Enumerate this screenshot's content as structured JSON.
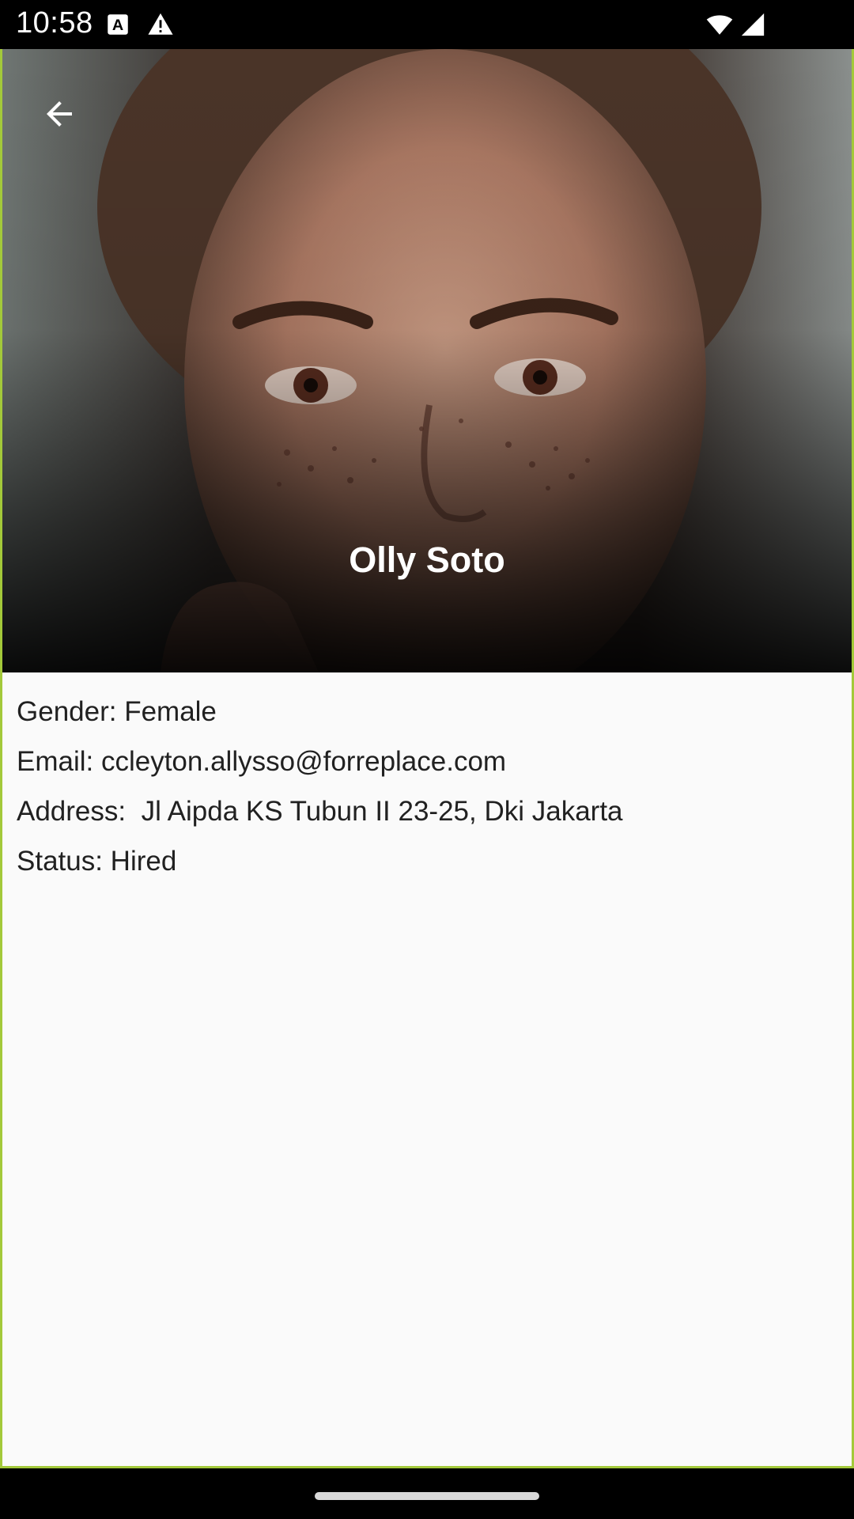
{
  "status_bar": {
    "time": "10:58",
    "icons": [
      "keyboard-a-icon",
      "warning-icon",
      "wifi-icon",
      "cell-signal-icon"
    ]
  },
  "header": {
    "back_icon": "arrow-back-icon",
    "name": "Olly Soto"
  },
  "details": {
    "gender": "Gender: Female",
    "email": "Email: ccleyton.allysso@forreplace.com",
    "address": "Address:  Jl Aipda KS Tubun II 23-25, Dki Jakarta",
    "status": "Status: Hired"
  },
  "colors": {
    "frame_border": "#a3c93a",
    "background": "#fafafa",
    "text": "#212121"
  }
}
